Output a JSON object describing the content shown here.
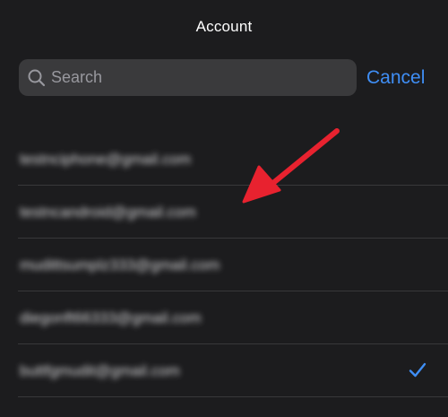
{
  "header": {
    "title": "Account"
  },
  "search": {
    "placeholder": "Search",
    "value": "",
    "cancel_label": "Cancel"
  },
  "accounts": [
    {
      "label": "testnciphone@gmail.com",
      "selected": false
    },
    {
      "label": "testncandroid@gmail.com",
      "selected": false
    },
    {
      "label": "mudittsumplz333@gmail.com",
      "selected": false
    },
    {
      "label": "diegonft66333@gmail.com",
      "selected": false
    },
    {
      "label": "buttfgmudit@gmail.com",
      "selected": true
    }
  ],
  "colors": {
    "accent": "#3f8ef5",
    "annotation_arrow": "#e8222f",
    "background": "#1c1c1e",
    "search_field": "#3a3a3c"
  },
  "icons": {
    "search": "magnifier-icon",
    "selected": "checkmark-icon",
    "annotation": "red-arrow-icon"
  }
}
